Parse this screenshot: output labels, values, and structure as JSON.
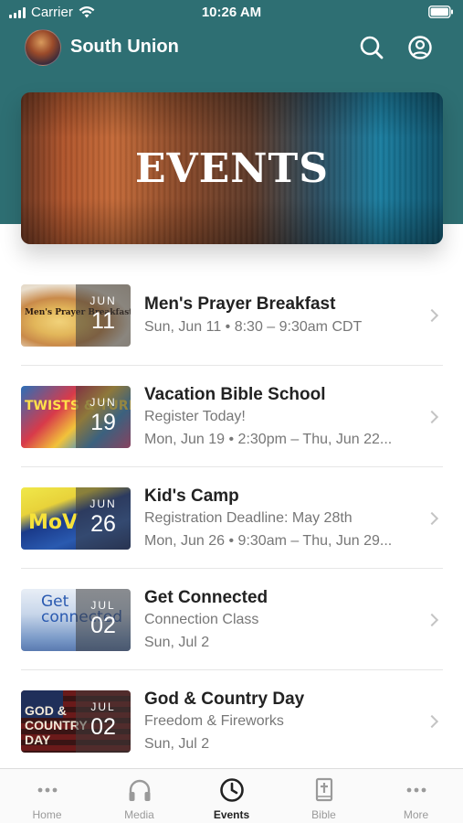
{
  "status_bar": {
    "carrier": "Carrier",
    "time": "10:26 AM",
    "icons": [
      "signal-icon",
      "wifi-icon",
      "battery-icon"
    ]
  },
  "header": {
    "title": "South Union",
    "icons": [
      "search-icon",
      "account-icon"
    ]
  },
  "banner": {
    "title": "EVENTS"
  },
  "events": [
    {
      "title": "Men's Prayer Breakfast",
      "lines": [
        "Sun, Jun 11 • 8:30 – 9:30am CDT"
      ],
      "month": "JUN",
      "day": "11",
      "thumb_caption": "Men's Prayer Breakfast"
    },
    {
      "title": "Vacation Bible School",
      "lines": [
        "Register Today!",
        "Mon, Jun 19 • 2:30pm – Thu, Jun 22..."
      ],
      "month": "JUN",
      "day": "19",
      "thumb_caption": "TWISTS & TURNS"
    },
    {
      "title": "Kid's Camp",
      "lines": [
        "Registration Deadline: May 28th",
        "Mon, Jun 26 • 9:30am – Thu, Jun 29..."
      ],
      "month": "JUN",
      "day": "26",
      "thumb_caption": "MoV"
    },
    {
      "title": "Get Connected",
      "lines": [
        "Connection Class",
        "Sun, Jul 2"
      ],
      "month": "JUL",
      "day": "02",
      "thumb_caption": "Get connected"
    },
    {
      "title": "God & Country Day",
      "lines": [
        "Freedom & Fireworks",
        "Sun, Jul 2"
      ],
      "month": "JUL",
      "day": "02",
      "thumb_caption": "GOD & COUNTRY DAY"
    }
  ],
  "tabs": [
    {
      "label": "Home",
      "icon": "more-dots-icon",
      "active": false
    },
    {
      "label": "Media",
      "icon": "headphones-icon",
      "active": false
    },
    {
      "label": "Events",
      "icon": "clock-icon",
      "active": true
    },
    {
      "label": "Bible",
      "icon": "bible-icon",
      "active": false
    },
    {
      "label": "More",
      "icon": "more-dots-icon",
      "active": false
    }
  ],
  "colors": {
    "header_bg": "#2e6f73",
    "active_tab": "#222222",
    "inactive_tab": "#9a9a9a"
  }
}
